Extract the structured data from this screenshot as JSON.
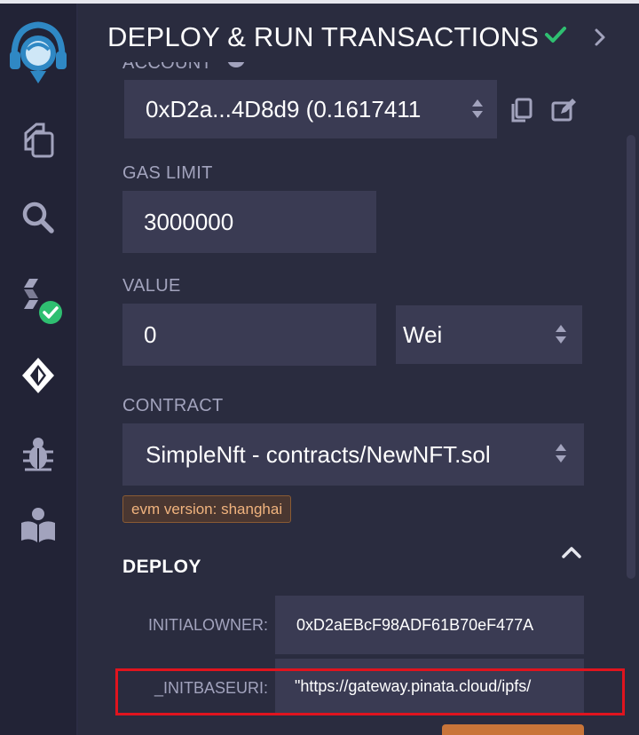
{
  "window": {
    "title": "DEPLOY & RUN TRANSACTIONS"
  },
  "sidebar": {
    "items": [
      {
        "name": "remix-logo-icon"
      },
      {
        "name": "file-explorer-icon"
      },
      {
        "name": "search-icon"
      },
      {
        "name": "solidity-compiler-icon"
      },
      {
        "name": "deploy-run-icon"
      },
      {
        "name": "debugger-icon"
      },
      {
        "name": "learneth-icon"
      }
    ]
  },
  "account": {
    "label": "ACCOUNT",
    "value": "0xD2a...4D8d9 (0.1617411"
  },
  "gas_limit": {
    "label": "GAS LIMIT",
    "value": "3000000"
  },
  "value": {
    "label": "VALUE",
    "amount": "0",
    "unit": "Wei"
  },
  "contract": {
    "label": "CONTRACT",
    "selected": "SimpleNft - contracts/NewNFT.sol",
    "evm_badge": "evm version: shanghai"
  },
  "deploy": {
    "heading": "DEPLOY",
    "params": [
      {
        "label": "INITIALOWNER:",
        "value": "0xD2aEBcF98ADF61B70eF477A"
      },
      {
        "label": "_INITBASEURI:",
        "value": "\"https://gateway.pinata.cloud/ipfs/"
      }
    ]
  },
  "colors": {
    "accent_check": "#2fbf71",
    "panel_bg": "#2a2c3f",
    "input_bg": "#3a3b53",
    "highlight": "#e0141e",
    "deploy_button": "#c97539"
  }
}
